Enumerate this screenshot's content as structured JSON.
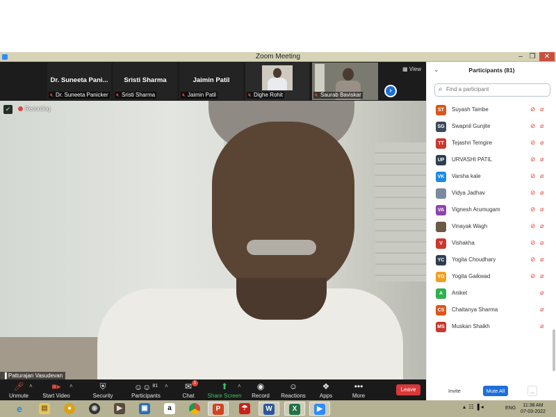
{
  "window": {
    "title": "Zoom Meeting",
    "minimize": "–",
    "restore": "❐",
    "close": "✕"
  },
  "strip": {
    "tiles": [
      {
        "big_name": "Dr. Suneeta Pani...",
        "label": "Dr. Suneeta Panicker"
      },
      {
        "big_name": "Sristi Sharma",
        "label": "Sristi Sharma"
      },
      {
        "big_name": "Jaimin Patil",
        "label": "Jaimin Patil"
      },
      {
        "big_name": "",
        "label": "Dighe Rohit"
      },
      {
        "big_name": "",
        "label": "Saurab Baviskar"
      }
    ],
    "view_label": "View"
  },
  "speaker": {
    "recording_label": "Recording",
    "name": "Patturajan Vasudevan"
  },
  "toolbar": {
    "unmute": "Unmute",
    "start_video": "Start Video",
    "security": "Security",
    "participants": "Participants",
    "participants_count": "81",
    "chat": "Chat",
    "chat_badge": "1",
    "share_screen": "Share Screen",
    "record": "Record",
    "reactions": "Reactions",
    "apps": "Apps",
    "more": "More",
    "leave": "Leave"
  },
  "panel": {
    "title": "Participants (81)",
    "search_placeholder": "Find a participant",
    "participants": [
      {
        "initials": "ST",
        "name": "Suyash Tambe",
        "color": "#d9561e",
        "mic_muted": true
      },
      {
        "initials": "SG",
        "name": "Swapnil Gunjite",
        "color": "#3a4a5c",
        "mic_muted": true
      },
      {
        "initials": "TT",
        "name": "Tejashri Temgire",
        "color": "#c8382e",
        "mic_muted": true
      },
      {
        "initials": "UP",
        "name": "URVASHI PATIL",
        "color": "#2f3e52",
        "mic_muted": true
      },
      {
        "initials": "VK",
        "name": "Varsha kale",
        "color": "#1e88e5",
        "mic_muted": true
      },
      {
        "initials": "",
        "name": "Vidya Jadhav",
        "color": "#7a8aa0",
        "mic_muted": true
      },
      {
        "initials": "VA",
        "name": "Vignesh Arumugam",
        "color": "#8e44ad",
        "mic_muted": true
      },
      {
        "initials": "",
        "name": "Vinayak Wagh",
        "color": "#6b5a45",
        "mic_muted": true
      },
      {
        "initials": "V",
        "name": "Vishakha",
        "color": "#c8382e",
        "mic_muted": true
      },
      {
        "initials": "YC",
        "name": "Yogita Choudhary",
        "color": "#2f3e52",
        "mic_muted": true
      },
      {
        "initials": "YG",
        "name": "Yogita Gaikwad",
        "color": "#f0a020",
        "mic_muted": true
      },
      {
        "initials": "A",
        "name": "Aniket",
        "color": "#2eb14a",
        "mic_muted": false
      },
      {
        "initials": "CS",
        "name": "Chaitanya Sharma",
        "color": "#d9561e",
        "mic_muted": false
      },
      {
        "initials": "MS",
        "name": "Muskan Shaikh",
        "color": "#c8382e",
        "mic_muted": false
      }
    ],
    "invite": "Invite",
    "mute_all": "Mute All",
    "more": "..."
  },
  "taskbar": {
    "lang": "ENG",
    "time": "11:38 AM",
    "date": "07-03-2022"
  }
}
